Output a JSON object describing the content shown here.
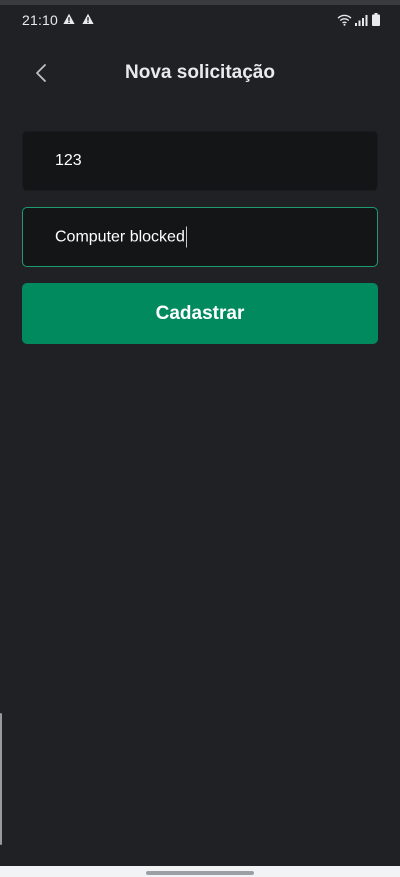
{
  "status_bar": {
    "time": "21:10",
    "icons": [
      "warning-icon",
      "warning-icon",
      "wifi-icon",
      "signal-icon",
      "battery-icon"
    ]
  },
  "header": {
    "back_icon": "chevron-left-icon",
    "title": "Nova solicitação"
  },
  "form": {
    "field_1_value": "123",
    "field_2_value": "Computer blocked",
    "submit_label": "Cadastrar"
  },
  "colors": {
    "background": "#202124",
    "field_background": "#141516",
    "focus_border": "#1f9c6f",
    "button": "#028a5f"
  }
}
